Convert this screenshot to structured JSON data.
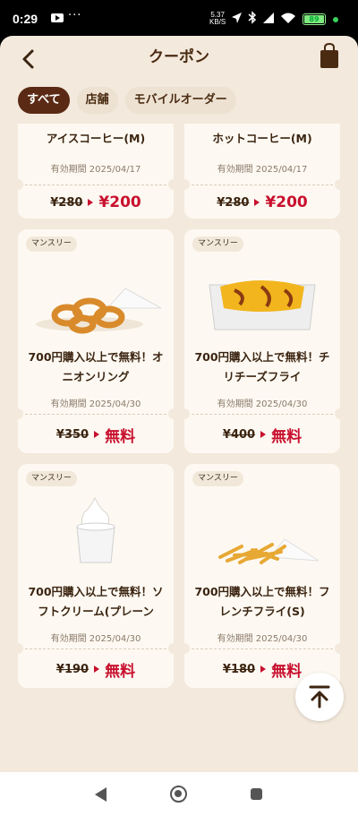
{
  "status_bar": {
    "time": "0:29",
    "dots": "···",
    "speed_top": "5.37",
    "speed_bottom": "KB/S",
    "battery": "89"
  },
  "header": {
    "title": "クーポン",
    "back_icon": "chevron-left-icon",
    "bag_icon": "shopping-bag-icon"
  },
  "tabs": [
    {
      "label": "すべて",
      "active": true
    },
    {
      "label": "店舗",
      "active": false
    },
    {
      "label": "モバイルオーダー",
      "active": false
    }
  ],
  "coupons": [
    {
      "badge": "",
      "name": "アイスコーヒー(M)",
      "valid": "有効期間 2025/04/17",
      "old_price": "¥280",
      "new_price": "¥200"
    },
    {
      "badge": "",
      "name": "ホットコーヒー(M)",
      "valid": "有効期間 2025/04/17",
      "old_price": "¥280",
      "new_price": "¥200"
    },
    {
      "badge": "マンスリー",
      "name_line1": "700円購入以上で無料！オ",
      "name_line2": "ニオンリング",
      "valid": "有効期間 2025/04/30",
      "old_price": "¥350",
      "new_price": "無料",
      "image": "onion-rings"
    },
    {
      "badge": "マンスリー",
      "name_line1": "700円購入以上で無料！チ",
      "name_line2": "リチーズフライ",
      "valid": "有効期間 2025/04/30",
      "old_price": "¥400",
      "new_price": "無料",
      "image": "chili-cheese-fries"
    },
    {
      "badge": "マンスリー",
      "name_line1": "700円購入以上で無料！ソ",
      "name_line2": "フトクリーム(プレーン",
      "valid": "有効期間 2025/04/30",
      "old_price": "¥190",
      "new_price": "無料",
      "image": "soft-serve"
    },
    {
      "badge": "マンスリー",
      "name_line1": "700円購入以上で無料！フ",
      "name_line2": "レンチフライ(S)",
      "valid": "有効期間 2025/04/30",
      "old_price": "¥180",
      "new_price": "無料",
      "image": "french-fries"
    }
  ],
  "colors": {
    "background": "#f3e9dc",
    "accent": "#c8102e",
    "brand_dark": "#5a2a14",
    "card": "#fdf9f2"
  },
  "fab_icon": "scroll-to-top-icon"
}
